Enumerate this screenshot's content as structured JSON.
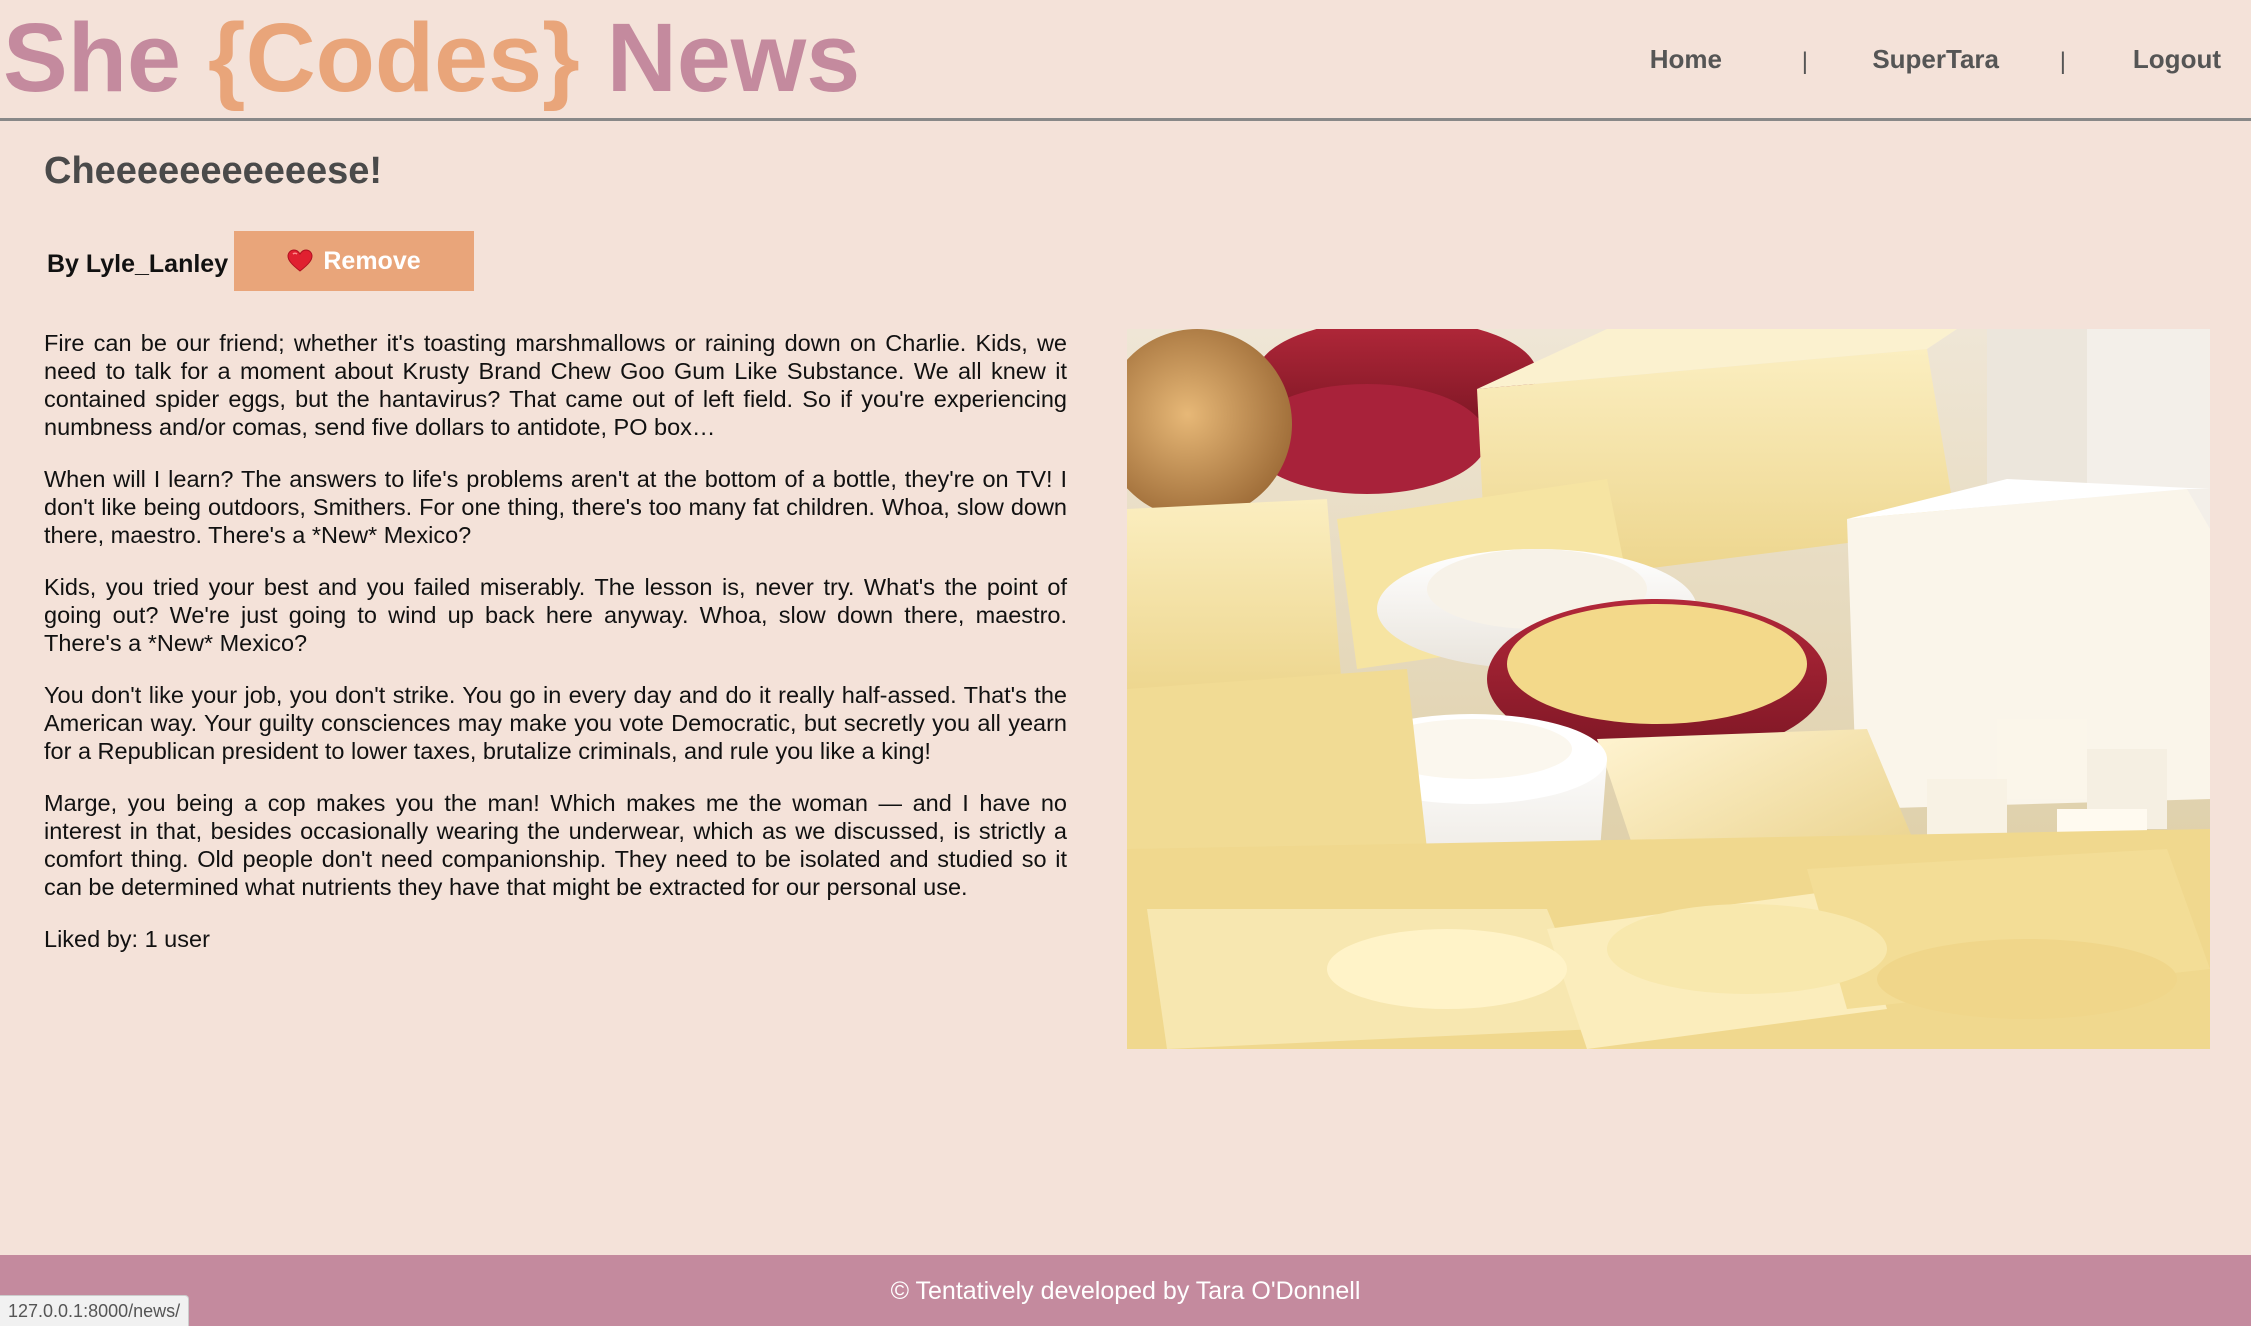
{
  "header": {
    "brand": {
      "part1": "She",
      "part2": "{Codes}",
      "part3": "News"
    },
    "nav": {
      "home": "Home",
      "user": "SuperTara",
      "logout": "Logout",
      "separator": "|"
    }
  },
  "article": {
    "title": "Cheeeeeeeeeeese!",
    "byline": "By Lyle_Lanley",
    "like_button": {
      "label": "Remove",
      "icon": "heart-icon"
    },
    "paragraphs": [
      "Fire can be our friend; whether it's toasting marshmallows or raining down on Charlie. Kids, we need to talk for a moment about Krusty Brand Chew Goo Gum Like Substance. We all knew it contained spider eggs, but the hantavirus? That came out of left field. So if you're experiencing numbness and/or comas, send five dollars to antidote, PO box…",
      "When will I learn? The answers to life's problems aren't at the bottom of a bottle, they're on TV! I don't like being outdoors, Smithers. For one thing, there's too many fat children. Whoa, slow down there, maestro. There's a *New* Mexico?",
      "Kids, you tried your best and you failed miserably. The lesson is, never try. What's the point of going out? We're just going to wind up back here anyway. Whoa, slow down there, maestro. There's a *New* Mexico?",
      "You don't like your job, you don't strike. You go in every day and do it really half-assed. That's the American way. Your guilty consciences may make you vote Democratic, but secretly you all yearn for a Republican president to lower taxes, brutalize criminals, and rule you like a king!",
      "Marge, you being a cop makes you the man! Which makes me the woman — and I have no interest in that, besides occasionally wearing the underwear, which as we discussed, is strictly a comfort thing. Old people don't need companionship. They need to be isolated and studied so it can be determined what nutrients they have that might be extracted for our personal use."
    ],
    "liked_by": "Liked by: 1 user"
  },
  "footer": {
    "text": "© Tentatively developed by Tara O'Donnell"
  },
  "status_bar": {
    "url": "127.0.0.1:8000/news/"
  },
  "colors": {
    "background": "#f4e2d9",
    "brand_pink": "#c48a9e",
    "brand_orange": "#e9a57a",
    "footer": "#c48a9e",
    "button": "#e9a57a"
  }
}
